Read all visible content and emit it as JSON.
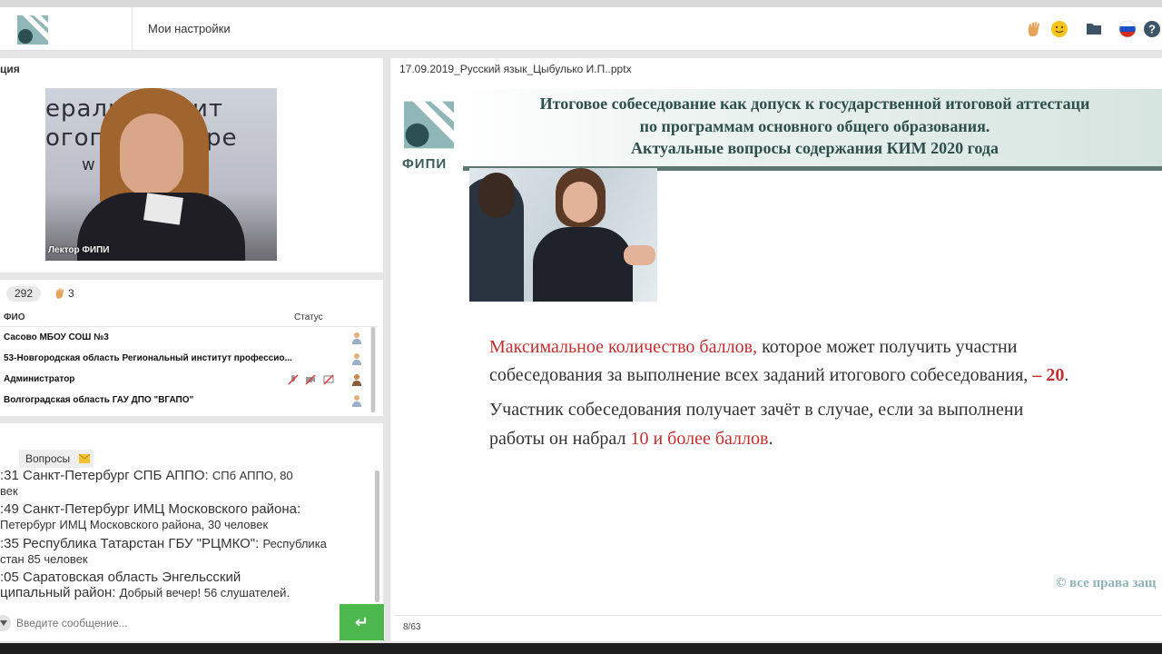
{
  "header": {
    "title": "Мои настройки"
  },
  "presentation_panel": {
    "title": "ция"
  },
  "video": {
    "wall_text_1": "ераль инстит",
    "wall_text_2": "огогич измере",
    "wall_text_3": "w w .ru",
    "caption": "Лектор ФИПИ"
  },
  "participants": {
    "count": "292",
    "hands": "3",
    "columns": {
      "name": "ФИО",
      "status": "Статус"
    },
    "rows": [
      {
        "name": "Сасово МБОУ СОШ №3"
      },
      {
        "name": "53-Новгородская область Региональный институт профессио..."
      },
      {
        "name": "Администратор"
      },
      {
        "name": "Волгоградская область ГАУ ДПО \"ВГАПО\""
      }
    ]
  },
  "chat": {
    "tab_label": "Вопросы",
    "messages": [
      {
        "line1a": ":31 Санкт-Петербург СПБ АППО: ",
        "line1b": "СПб АППО, 80",
        "line2": "век"
      },
      {
        "line1a": ":49 Санкт-Петербург ИМЦ Московского района:",
        "line2": "Петербург ИМЦ Московского района, 30 человек"
      },
      {
        "line1a": ":35 Республика Татарстан ГБУ \"РЦМКО\": ",
        "line1b": "Республика",
        "line2": "стан 85 человек"
      },
      {
        "line1a": ":05 Саратовская область Энгельсский",
        "line2a": "ципальный район: ",
        "line2b": "Добрый вечер! 56 слушателей."
      }
    ],
    "input_placeholder": "Введите сообщение...",
    "send_label": "↵"
  },
  "slide": {
    "file_name": "17.09.2019_Русский язык_Цыбулько И.П..pptx",
    "logo_text": "ФИПИ",
    "title_1": "Итоговое собеседование как допуск к государственной итоговой аттестаци",
    "title_2": "по программам основного общего образования.",
    "title_3": "Актуальные вопросы содержания КИМ 2020 года",
    "p1_red": "Максимальное количество баллов,",
    "p1_rest": " которое может получить участни",
    "p1_line2": "собеседования за выполнение всех заданий итогового собеседования, ",
    "p1_red2": "– 20",
    "p1_dot": ".",
    "p2_line1": "Участник собеседования получает зачёт в случае, если за выполнени",
    "p2_line2": "работы он набрал ",
    "p2_red": "10 и более баллов",
    "p2_dot": ".",
    "copyright": "© все права защ",
    "page": "8/63"
  },
  "colors": {
    "accent_green": "#4cb84d",
    "slide_red": "#c12f2f",
    "slide_title": "#2f4f4a"
  }
}
